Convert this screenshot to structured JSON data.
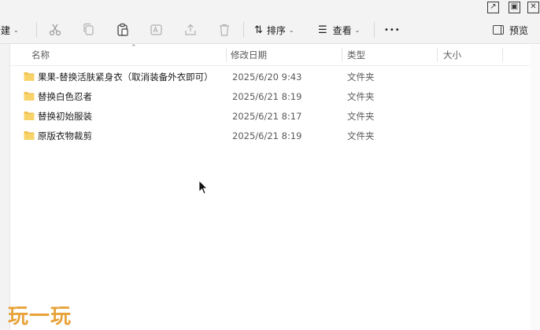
{
  "toolbar": {
    "new_label": "新建",
    "sort_label": "排序",
    "view_label": "查看",
    "more_label": "•••",
    "preview_label": "预览"
  },
  "columns": {
    "name": "名称",
    "date": "修改日期",
    "type": "类型",
    "size": "大小"
  },
  "files": [
    {
      "name": "果果-替换活肤紧身衣（取消装备外衣即可）",
      "date": "2025/6/20 9:43",
      "type": "文件夹"
    },
    {
      "name": "替换白色忍者",
      "date": "2025/6/21 8:19",
      "type": "文件夹"
    },
    {
      "name": "替换初始服装",
      "date": "2025/6/21 8:17",
      "type": "文件夹"
    },
    {
      "name": "原版衣物裁剪",
      "date": "2025/6/21 8:19",
      "type": "文件夹"
    }
  ],
  "watermark": "玩一玩",
  "colors": {
    "folder": "#f2c250",
    "accent": "#e8a23a"
  }
}
